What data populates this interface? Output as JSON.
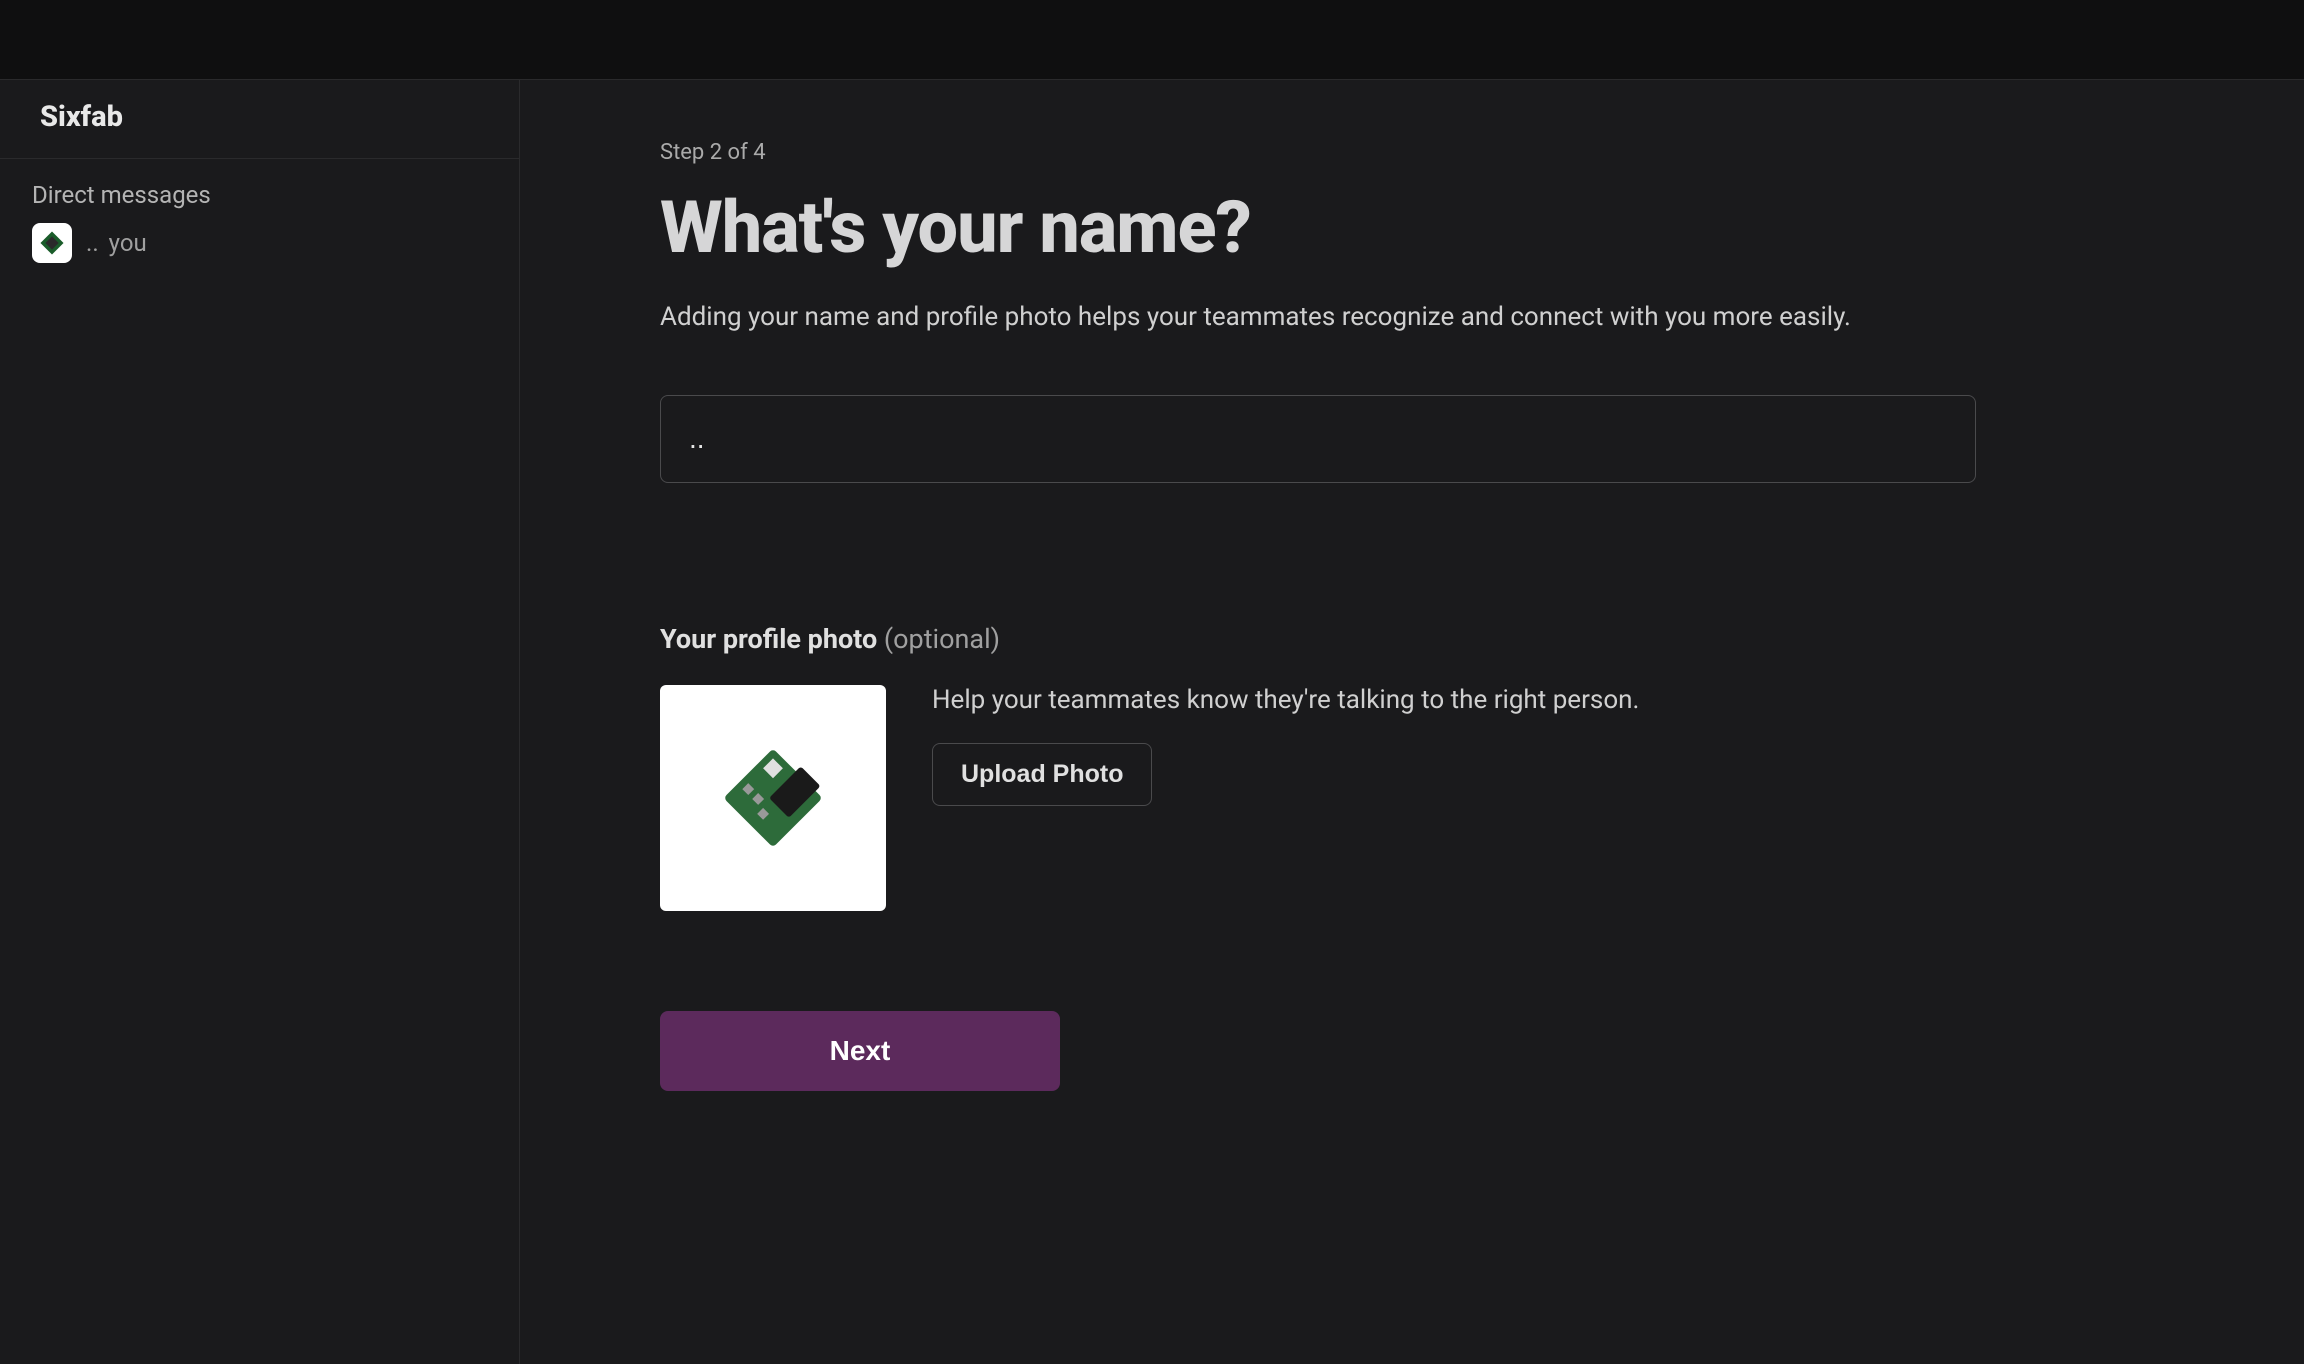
{
  "sidebar": {
    "workspace_name": "Sixfab",
    "dm_section_title": "Direct messages",
    "dm_item_prefix": "..",
    "dm_item_label": "you"
  },
  "main": {
    "step_label": "Step 2 of 4",
    "heading": "What's your name?",
    "subtext": "Adding your name and profile photo helps your teammates recognize and connect with you more easily.",
    "name_input_value": "..",
    "profile_photo": {
      "label": "Your profile photo",
      "optional_label": " (optional)",
      "help_text": "Help your teammates know they're talking to the right person.",
      "upload_button_label": "Upload Photo"
    },
    "next_button_label": "Next"
  }
}
